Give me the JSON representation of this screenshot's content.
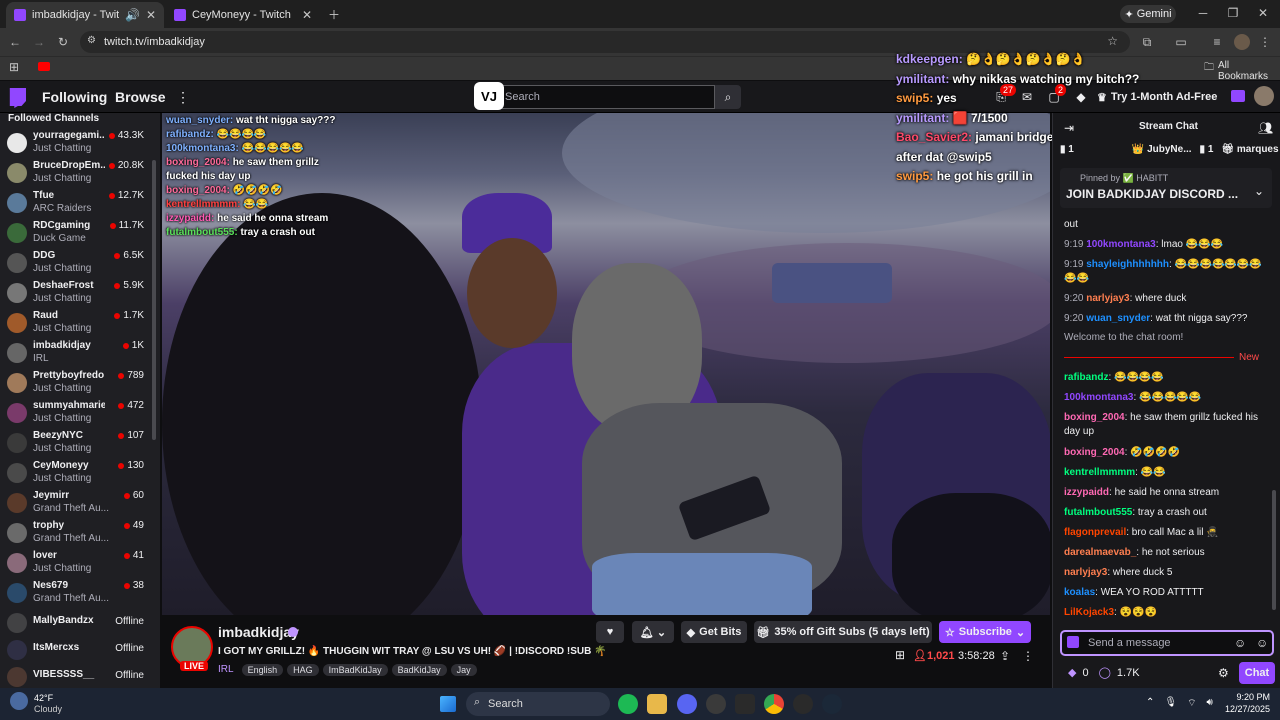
{
  "browser": {
    "tabs": [
      {
        "title": "imbadkidjay - Twitch",
        "active": true
      },
      {
        "title": "CeyMoneyy - Twitch",
        "active": false
      }
    ],
    "gemini_label": "Gemini",
    "url": "twitch.tv/imbadkidjay",
    "all_bookmarks": "All Bookmarks"
  },
  "nav": {
    "following": "Following",
    "browse": "Browse",
    "search_placeholder": "Search",
    "logo_text": "VJ",
    "notif_badge_1": "27",
    "notif_badge_2": "2",
    "adfree": "Try 1-Month Ad-Free"
  },
  "sidebar": {
    "title": "Followed Channels",
    "channels": [
      {
        "name": "yourragegami...",
        "game": "Just Chatting",
        "viewers": "43.3K",
        "color": "#e8e8e8"
      },
      {
        "name": "BruceDropEm...",
        "game": "Just Chatting",
        "viewers": "20.8K",
        "color": "#8a8a6a"
      },
      {
        "name": "Tfue",
        "game": "ARC Raiders",
        "viewers": "12.7K",
        "color": "#5a7a9a"
      },
      {
        "name": "RDCgaming",
        "game": "Duck Game",
        "viewers": "11.7K",
        "color": "#3a6a3a"
      },
      {
        "name": "DDG",
        "game": "Just Chatting",
        "viewers": "6.5K",
        "color": "#555"
      },
      {
        "name": "DeshaeFrost",
        "game": "Just Chatting",
        "viewers": "5.9K",
        "color": "#777"
      },
      {
        "name": "Raud",
        "game": "Just Chatting",
        "viewers": "1.7K",
        "color": "#a05a2a"
      },
      {
        "name": "imbadkidjay",
        "game": "IRL",
        "viewers": "1K",
        "color": "#666"
      },
      {
        "name": "Prettyboyfredo",
        "game": "Just Chatting",
        "viewers": "789",
        "color": "#a07a5a"
      },
      {
        "name": "summyahmarie",
        "game": "Just Chatting",
        "viewers": "472",
        "color": "#7a3a6a"
      },
      {
        "name": "BeezyNYC",
        "game": "Just Chatting",
        "viewers": "107",
        "color": "#3a3a3a"
      },
      {
        "name": "CeyMoneyy",
        "game": "Just Chatting",
        "viewers": "130",
        "color": "#4a4a4a"
      },
      {
        "name": "Jeymirr",
        "game": "Grand Theft Au...",
        "viewers": "60",
        "color": "#5a3a2a"
      },
      {
        "name": "trophy",
        "game": "Grand Theft Au...",
        "viewers": "49",
        "color": "#6a6a6a"
      },
      {
        "name": "lover",
        "game": "Just Chatting",
        "viewers": "41",
        "color": "#8a6a7a"
      },
      {
        "name": "Nes679",
        "game": "Grand Theft Au...",
        "viewers": "38",
        "color": "#2a4a6a"
      }
    ],
    "offline": [
      {
        "name": "MallyBandzx",
        "status": "Offline",
        "color": "#5a5a5a"
      },
      {
        "name": "ItsMercxs",
        "status": "Offline",
        "color": "#3a3a5a"
      },
      {
        "name": "VIBESSSS__",
        "status": "Offline",
        "color": "#6a4a3a"
      }
    ]
  },
  "video_chat": [
    {
      "user": "wuan_snyder:",
      "text": "wat tht nigga say???",
      "color": "#7fb1ff"
    },
    {
      "user": "rafibandz:",
      "text": "😂😂😂😂",
      "color": "#7fb1ff"
    },
    {
      "user": "100kmontana3:",
      "text": "😂😂😂😂😂",
      "color": "#7fb1ff"
    },
    {
      "user": "boxing_2004:",
      "text": "he saw them grillz",
      "color": "#ff6a9a"
    },
    {
      "user": "",
      "text": "fucked his day up",
      "color": "#fff"
    },
    {
      "user": "boxing_2004:",
      "text": "🤣🤣🤣🤣",
      "color": "#ff6a9a"
    },
    {
      "user": "kentrellmmmm:",
      "text": "😂😂",
      "color": "#ff4040"
    },
    {
      "user": "izzypaidd:",
      "text": "he said he onna stream",
      "color": "#ff5ab3"
    },
    {
      "user": "futalmbout555:",
      "text": "tray a crash out",
      "color": "#5ae05a"
    }
  ],
  "overlay_chat": [
    {
      "user": "kdkeepgen:",
      "text": "🤔👌🤔👌🤔👌🤔👌",
      "color": "#b89aff"
    },
    {
      "user": "ymilitant:",
      "text": "why nikkas watching my bitch??",
      "color": "#b89aff"
    },
    {
      "user": "swip5:",
      "text": "yes",
      "color": "#ff9a40"
    },
    {
      "user": "ymilitant:",
      "text": "🟥 7/1500",
      "color": "#b89aff"
    },
    {
      "user": "Bao_Savier2:",
      "text": "jamani bridges gone b gone",
      "color": "#ff4a6a"
    },
    {
      "user": "",
      "text": "after dat @swip5",
      "color": "#fff"
    },
    {
      "user": "swip5:",
      "text": "he got his grill in",
      "color": "#ff9a40"
    }
  ],
  "stream": {
    "channel": "imbadkidjay",
    "live": "LIVE",
    "title": "I GOT MY GRILLZ! 🔥 THUGGIN WIT TRAY @ LSU VS UH! 🏈 | !DISCORD !SUB 🌴",
    "category": "IRL",
    "tags": [
      "English",
      "HAG",
      "ImBadKidJay",
      "BadKidJay",
      "Jay"
    ],
    "get_bits": "Get Bits",
    "gift_subs": "35% off Gift Subs (5 days left)",
    "subscribe": "Subscribe",
    "viewers": "1,021",
    "uptime": "3:58:28"
  },
  "chat": {
    "header": "Stream Chat",
    "leaderboard": [
      {
        "rank": "1",
        "name": ""
      },
      {
        "rank": "",
        "name": "JubyNe..."
      },
      {
        "rank": "1",
        "name": "marques"
      }
    ],
    "pinned_by": "Pinned by ✅ HABITT",
    "pinned_text": "JOIN BADKIDJAY DISCORD ...",
    "messages": [
      {
        "time": "",
        "user": "",
        "text": "out",
        "color": "#efeff1"
      },
      {
        "time": "9:19",
        "user": "100kmontana3",
        "text": ": lmao 😂😂😂",
        "color": "#9147ff"
      },
      {
        "time": "9:19",
        "user": "shayleighhhhhhh",
        "text": ": 😂😂😂😂😂😂😂😂😂",
        "color": "#1e90ff"
      },
      {
        "time": "9:20",
        "user": "narlyjay3",
        "text": ": where duck",
        "color": "#ff7f50"
      },
      {
        "time": "9:20",
        "user": "wuan_snyder",
        "text": ": wat tht nigga say???",
        "color": "#1e90ff"
      }
    ],
    "welcome": "Welcome to the chat room!",
    "new_label": "New",
    "messages2": [
      {
        "user": "rafibandz",
        "text": ": 😂😂😂😂",
        "color": "#00ff7f"
      },
      {
        "user": "100kmontana3",
        "text": ": 😂😂😂😂😂",
        "color": "#9147ff"
      },
      {
        "user": "boxing_2004",
        "text": ": he saw them grillz fucked his day up",
        "color": "#ff69b4"
      },
      {
        "user": "boxing_2004",
        "text": ": 🤣🤣🤣🤣",
        "color": "#ff69b4"
      },
      {
        "user": "kentrellmmmm",
        "text": ": 😂😂",
        "color": "#00ff7f"
      },
      {
        "user": "izzypaidd",
        "text": ": he said he onna stream",
        "color": "#ff69b4"
      },
      {
        "user": "futalmbout555",
        "text": ": tray a crash out",
        "color": "#00ff7f"
      },
      {
        "user": "flagonprevail",
        "text": ": bro call Mac a lil 🥷",
        "color": "#ff4500"
      },
      {
        "user": "darealmaevab_",
        "text": ": he not serious",
        "color": "#ff7f50"
      },
      {
        "user": "narlyjay3",
        "text": ": where duck 5",
        "color": "#ff7f50"
      },
      {
        "user": "koalas",
        "text": ": WEA YO ROD ATTTTT",
        "color": "#1e90ff"
      },
      {
        "user": "LilKojack3",
        "text": ": 😵😵😵",
        "color": "#ff4500"
      }
    ],
    "input_placeholder": "Send a message",
    "points": "0",
    "bits_count": "1.7K",
    "chat_button": "Chat"
  },
  "taskbar": {
    "weather_temp": "42°F",
    "weather_desc": "Cloudy",
    "search": "Search",
    "time": "9:20 PM",
    "date": "12/27/2025"
  },
  "colors": {
    "twitch_purple": "#9147ff",
    "live_red": "#eb0400"
  }
}
